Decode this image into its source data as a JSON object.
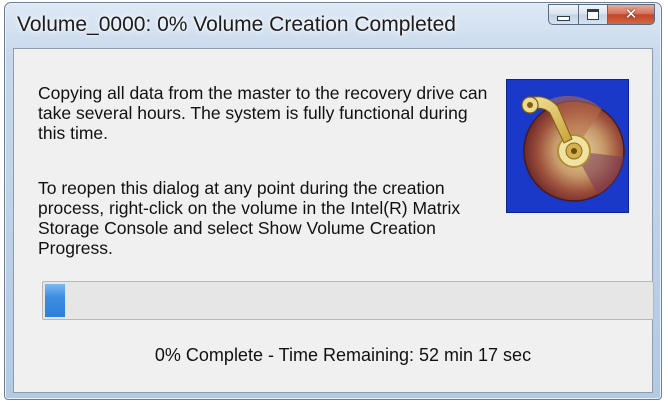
{
  "window": {
    "title": "Volume_0000: 0% Volume Creation Completed",
    "buttons": {
      "minimize": "minimize-icon",
      "maximize": "maximize-icon",
      "close": "close-icon"
    }
  },
  "dialog": {
    "message1": "Copying all data from the master to the recovery drive can take several hours. The system is fully functional during this time.",
    "message2": "To reopen this dialog at any point during the creation process, right-click on the volume in the Intel(R) Matrix Storage Console and select Show Volume Creation Progress.",
    "image": "hard-drive-icon"
  },
  "progress": {
    "percent_complete": 0,
    "status_text": "0% Complete - Time Remaining: 52 min 17 sec"
  },
  "colors": {
    "progress_fill": "#3b8ee3",
    "image_background": "#1a39c9",
    "close_button": "#c2452c"
  }
}
